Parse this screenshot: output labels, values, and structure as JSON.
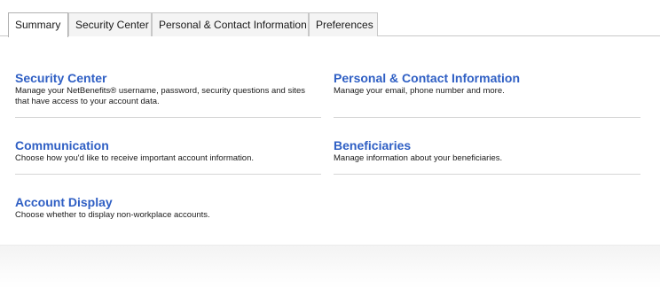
{
  "tabs": [
    {
      "label": "Summary",
      "active": true
    },
    {
      "label": "Security Center",
      "active": false
    },
    {
      "label": "Personal & Contact Information",
      "active": false
    },
    {
      "label": "Preferences",
      "active": false
    }
  ],
  "cards": {
    "security": {
      "title": "Security Center",
      "description": "Manage your NetBenefits® username, password, security questions and sites that have access to your account data."
    },
    "personal": {
      "title": "Personal & Contact Information",
      "description": "Manage your email, phone number and more."
    },
    "communication": {
      "title": "Communication",
      "description": "Choose how you'd like to receive important account information."
    },
    "beneficiaries": {
      "title": "Beneficiaries",
      "description": "Manage information about your beneficiaries."
    },
    "account_display": {
      "title": "Account Display",
      "description": "Choose whether to display non-workplace accounts."
    }
  },
  "colors": {
    "link": "#2f5fc4",
    "divider": "#d6d6d6",
    "tab_border": "#c8c8c8"
  }
}
